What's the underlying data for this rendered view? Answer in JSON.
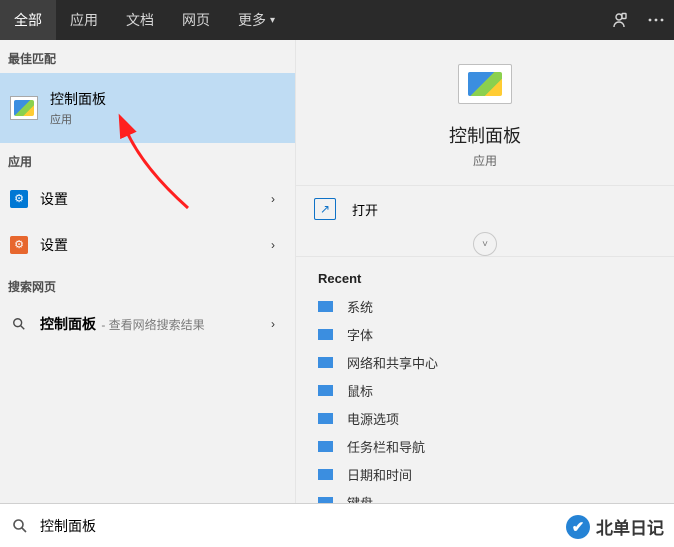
{
  "topbar": {
    "tabs": {
      "t0": "全部",
      "t1": "应用",
      "t2": "文档",
      "t3": "网页",
      "t4": "更多"
    }
  },
  "left": {
    "best_header": "最佳匹配",
    "best": {
      "title": "控制面板",
      "sub": "应用"
    },
    "apps_header": "应用",
    "apps": {
      "a0": "设置",
      "a1": "设置"
    },
    "web_header": "搜索网页",
    "web": {
      "term": "控制面板",
      "hint": " - 查看网络搜索结果"
    }
  },
  "right": {
    "name": "控制面板",
    "kind": "应用",
    "open": "打开",
    "recent_header": "Recent",
    "recent": {
      "r0": "系统",
      "r1": "字体",
      "r2": "网络和共享中心",
      "r3": "鼠标",
      "r4": "电源选项",
      "r5": "任务栏和导航",
      "r6": "日期和时间",
      "r7": "键盘"
    }
  },
  "search": {
    "value": "控制面板"
  },
  "watermark": {
    "text": "北单日记"
  }
}
